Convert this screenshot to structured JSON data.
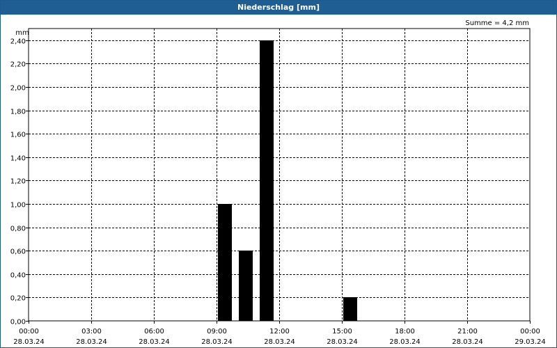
{
  "title": "Niederschlag [mm]",
  "chart_data": {
    "type": "bar",
    "title": "Niederschlag [mm]",
    "ylabel": "mm",
    "annotation": "Summe = 4,2 mm",
    "ylim": [
      0,
      2.5
    ],
    "yticks": [
      "0,00",
      "0,20",
      "0,40",
      "0,60",
      "0,80",
      "1,00",
      "1,20",
      "1,40",
      "1,60",
      "1,80",
      "2,00",
      "2,20",
      "2,40"
    ],
    "xlim_hours": [
      0,
      24
    ],
    "xticks": [
      {
        "time": "00:00",
        "date": "28.03.24"
      },
      {
        "time": "03:00",
        "date": "28.03.24"
      },
      {
        "time": "06:00",
        "date": "28.03.24"
      },
      {
        "time": "09:00",
        "date": "28.03.24"
      },
      {
        "time": "12:00",
        "date": "28.03.24"
      },
      {
        "time": "15:00",
        "date": "28.03.24"
      },
      {
        "time": "18:00",
        "date": "28.03.24"
      },
      {
        "time": "21:00",
        "date": "28.03.24"
      },
      {
        "time": "00:00",
        "date": "29.03.24"
      }
    ],
    "bars": [
      {
        "x": "09:00",
        "value": 1.0
      },
      {
        "x": "10:00",
        "value": 0.6
      },
      {
        "x": "11:00",
        "value": 2.4
      },
      {
        "x": "15:00",
        "value": 0.2
      }
    ],
    "grid": true,
    "bar_color": "#000000"
  }
}
